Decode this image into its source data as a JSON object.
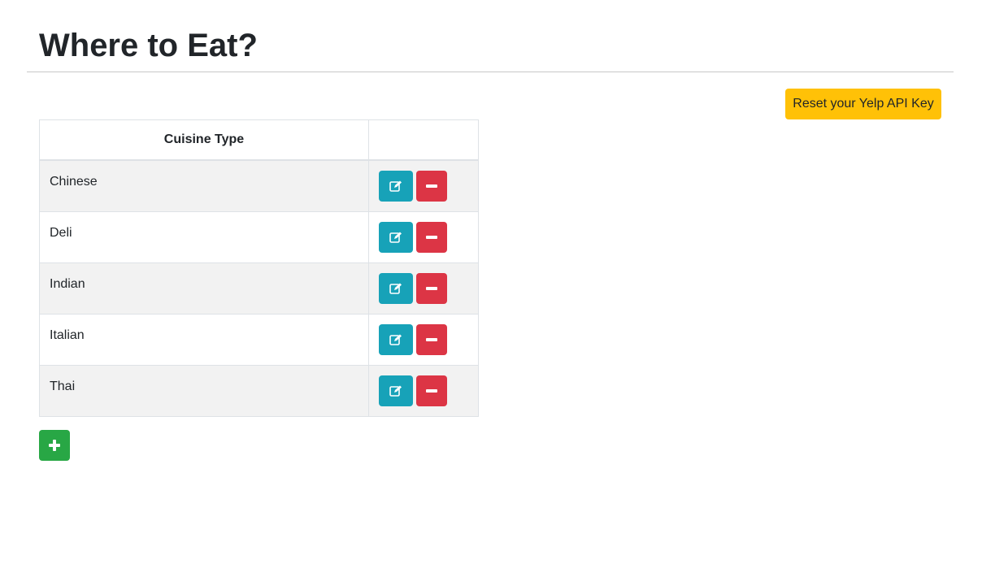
{
  "header": {
    "title": "Where to Eat?"
  },
  "actions": {
    "reset_label": "Reset your Yelp API Key"
  },
  "table": {
    "columns": [
      "Cuisine Type",
      ""
    ],
    "rows": [
      {
        "name": "Chinese"
      },
      {
        "name": "Deli"
      },
      {
        "name": "Indian"
      },
      {
        "name": "Italian"
      },
      {
        "name": "Thai"
      }
    ]
  },
  "icons": {
    "edit": "edit-icon",
    "remove": "minus-icon",
    "add": "plus-icon"
  },
  "colors": {
    "warning": "#ffc107",
    "info": "#17a2b8",
    "danger": "#dc3545",
    "success": "#28a745"
  }
}
